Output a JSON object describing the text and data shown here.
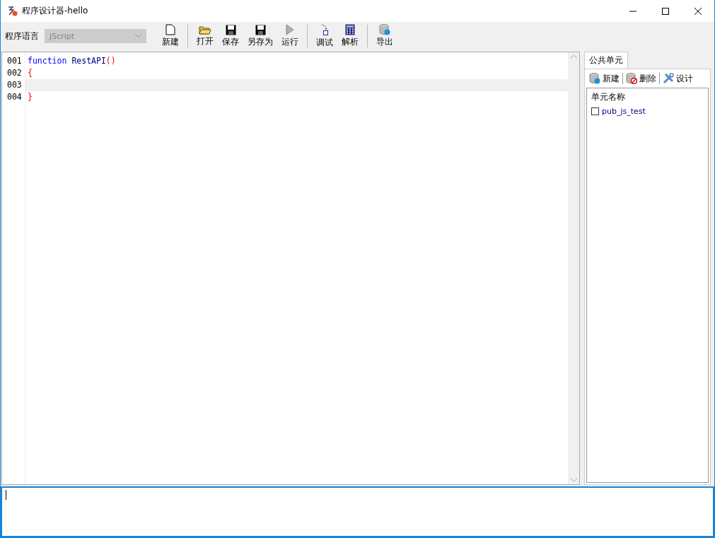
{
  "window": {
    "title": "程序设计器-hello"
  },
  "toolbar": {
    "language_label": "程序语言",
    "language_combo": {
      "value": "JScript",
      "disabled": true
    },
    "groups": [
      [
        {
          "label": "新建",
          "kind": "new"
        }
      ],
      [
        {
          "label": "打开",
          "kind": "open"
        },
        {
          "label": "保存",
          "kind": "save"
        },
        {
          "label": "另存为",
          "kind": "save"
        },
        {
          "label": "运行",
          "kind": "run"
        }
      ],
      [
        {
          "label": "调试",
          "kind": "debug"
        },
        {
          "label": "解析",
          "kind": "calc"
        }
      ],
      [
        {
          "label": "导出",
          "kind": "db"
        }
      ]
    ]
  },
  "editor": {
    "lines": [
      {
        "number": "001",
        "current": false,
        "tokens": [
          {
            "text": "function",
            "kind": "keyword"
          },
          {
            "text": "RestAPI",
            "kind": "name"
          },
          {
            "text": "()",
            "kind": "paren"
          }
        ]
      },
      {
        "number": "002",
        "current": false,
        "tokens": [
          {
            "text": "{",
            "kind": "paren"
          }
        ]
      },
      {
        "number": "003",
        "current": true
      },
      {
        "number": "004",
        "current": false,
        "tokens": [
          {
            "text": "}",
            "kind": "paren"
          }
        ]
      }
    ]
  },
  "side_panel": {
    "tab": "公共单元",
    "buttons": [
      {
        "label": "新建",
        "kind": "db-add"
      },
      {
        "label": "删除",
        "kind": "db-delete"
      },
      {
        "label": "设计",
        "kind": "tools"
      }
    ],
    "list": {
      "header": "单元名称",
      "items": [
        {
          "label": "pub_js_test",
          "checked": false
        }
      ]
    }
  }
}
